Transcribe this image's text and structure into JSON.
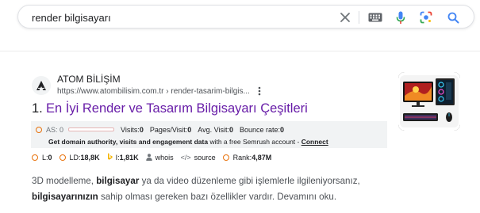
{
  "search": {
    "query": "render bilgisayarı"
  },
  "result": {
    "number": "1.",
    "site_name": "ATOM BİLİŞİM",
    "url": "https://www.atombilisim.com.tr › render-tasarim-bilgis...",
    "title": "En İyi Render ve Tasarım Bilgisayarı Çeşitleri",
    "snippet_1": "3D modelleme, ",
    "snippet_bold_1": "bilgisayar",
    "snippet_2": " ya da video düzenleme gibi işlemlerle ilgileniyorsanız,",
    "snippet_bold_2": "bilgisayarınızın",
    "snippet_3": " sahip olması gereken bazı özellikler vardır. Devamını oku."
  },
  "seo": {
    "as_label": "AS: 0",
    "visits_label": "Visits: ",
    "visits_value": "0",
    "pages_label": "Pages/Visit: ",
    "pages_value": "0",
    "avg_label": "Avg. Visit: ",
    "avg_value": "0",
    "bounce_label": "Bounce rate: ",
    "bounce_value": "0",
    "promo_prefix": "Get domain authority, ",
    "promo_visits": "visits",
    "promo_mid": " and ",
    "promo_engagement": "engagement data",
    "promo_suffix": " with a free Semrush account - ",
    "promo_link": "Connect",
    "accent": "#e8710a"
  },
  "metrics": {
    "l_label": "L: ",
    "l_value": "0",
    "ld_label": "LD: ",
    "ld_value": "18,8K",
    "i_label": "I: ",
    "i_value": "1,81K",
    "whois_label": "whois",
    "source_label": "source",
    "rank_label": "Rank: ",
    "rank_value": "4,87M"
  },
  "colors": {
    "visited_title": "#681da8",
    "mic_blue": "#4285f4",
    "lens_multi": "#34a853",
    "search_blue": "#4285f4"
  },
  "icons": {
    "clear": "close-icon",
    "keyboard": "keyboard-icon",
    "mic": "microphone-icon",
    "lens": "google-lens-icon",
    "search": "search-icon",
    "favicon": "atom-logo-icon",
    "more": "more-vert-icon"
  }
}
